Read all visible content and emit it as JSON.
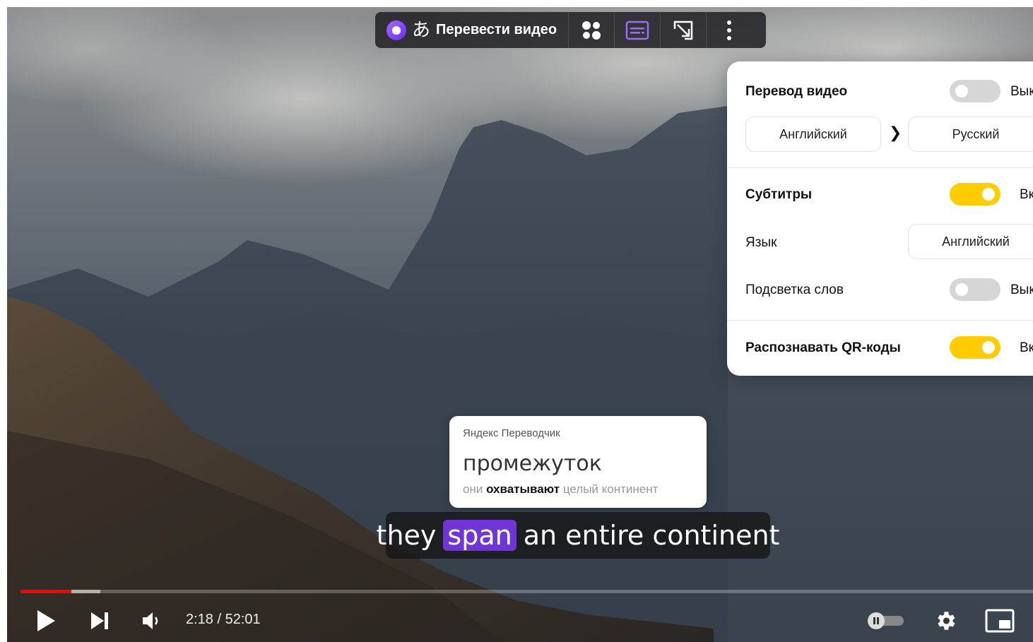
{
  "translate_bar": {
    "label": "Перевести видео",
    "jp_glyph": "あ",
    "icons": [
      "alice-icon",
      "translate-icon",
      "apps-icon",
      "subtitles-icon",
      "expand-icon",
      "more-vertical-icon"
    ],
    "accent": "#8e5cff"
  },
  "settings": {
    "video_translation": {
      "title": "Перевод видео",
      "state": "Вык",
      "enabled": false
    },
    "from_lang": "Английский",
    "to_lang": "Русский",
    "arrow": "❯",
    "subtitles": {
      "title": "Субтитры",
      "state": "Вк",
      "enabled": true
    },
    "language_label": "Язык",
    "language_value": "Английский",
    "word_highlight": {
      "title": "Подсветка слов",
      "state": "Вык",
      "enabled": false
    },
    "qr_codes": {
      "title": "Распознавать QR-коды",
      "state": "Вк",
      "enabled": true
    },
    "toggle_on_color": "#ffcc00",
    "toggle_off_color": "#d6d6d6"
  },
  "dictionary": {
    "source": "Яндекс Переводчик",
    "word": "промежуток",
    "context_before": "они ",
    "context_bold": "охватывают",
    "context_after": " целый континент"
  },
  "subtitle": {
    "before": "they",
    "highlight": "span",
    "after": "an entire continent",
    "highlight_color": "#6f35d6"
  },
  "player": {
    "time": "2:18 / 52:01",
    "played_fraction": 0.05,
    "buffered_fraction": 0.079,
    "progress_color": "#ff0000",
    "icons": [
      "play-icon",
      "next-icon",
      "volume-icon",
      "autoplay-toggle-icon",
      "settings-gear-icon",
      "miniplayer-icon"
    ]
  }
}
